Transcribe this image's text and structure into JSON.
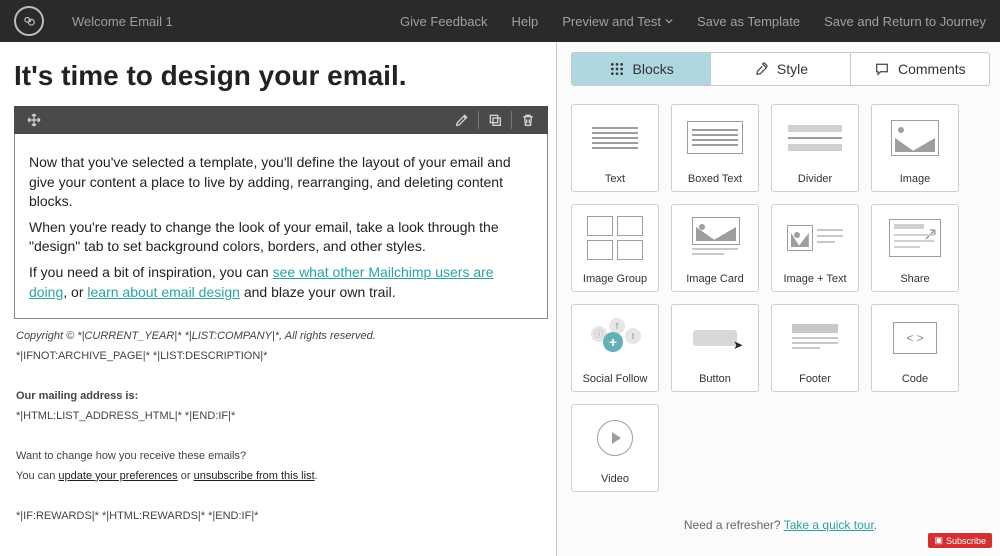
{
  "topbar": {
    "title": "Welcome Email 1",
    "links": {
      "feedback": "Give Feedback",
      "help": "Help",
      "preview": "Preview and Test",
      "template": "Save as Template",
      "save": "Save and Return to Journey"
    }
  },
  "editor": {
    "heading": "It's time to design your email.",
    "p1a": "Now that you've selected a template, you'll define the layout of your email and give your content a place to live by adding, rearranging, and deleting content blocks.",
    "p2a": "When you're ready to change the look of your email, take a look through the \"design\" tab to set background colors, borders, and other styles.",
    "p3_pre": "If you need a bit of inspiration, you can ",
    "p3_link1": "see what other Mailchimp users are doing",
    "p3_mid": ", or ",
    "p3_link2": "learn about email design",
    "p3_post": " and blaze your own trail."
  },
  "footer": {
    "copyright": "Copyright © *|CURRENT_YEAR|* *|LIST:COMPANY|*, All rights reserved.",
    "archive": "*|IFNOT:ARCHIVE_PAGE|* *|LIST:DESCRIPTION|*",
    "addr_label": "Our mailing address is:",
    "addr": "*|HTML:LIST_ADDRESS_HTML|* *|END:IF|*",
    "change": "Want to change how you receive these emails?",
    "you_can": "You can ",
    "update": "update your preferences",
    "or": " or ",
    "unsub": "unsubscribe from this list",
    "period": ".",
    "rewards": "*|IF:REWARDS|* *|HTML:REWARDS|* *|END:IF|*"
  },
  "panel": {
    "tabs": {
      "blocks": "Blocks",
      "style": "Style",
      "comments": "Comments"
    },
    "blocks": {
      "text": "Text",
      "boxed": "Boxed Text",
      "divider": "Divider",
      "image": "Image",
      "imagegroup": "Image Group",
      "imagecard": "Image Card",
      "imagetext": "Image + Text",
      "share": "Share",
      "social": "Social Follow",
      "button": "Button",
      "footer": "Footer",
      "code": "Code",
      "video": "Video"
    },
    "refresher_pre": "Need a refresher? ",
    "refresher_link": "Take a quick tour",
    "refresher_post": "."
  },
  "badge": "Subscribe"
}
